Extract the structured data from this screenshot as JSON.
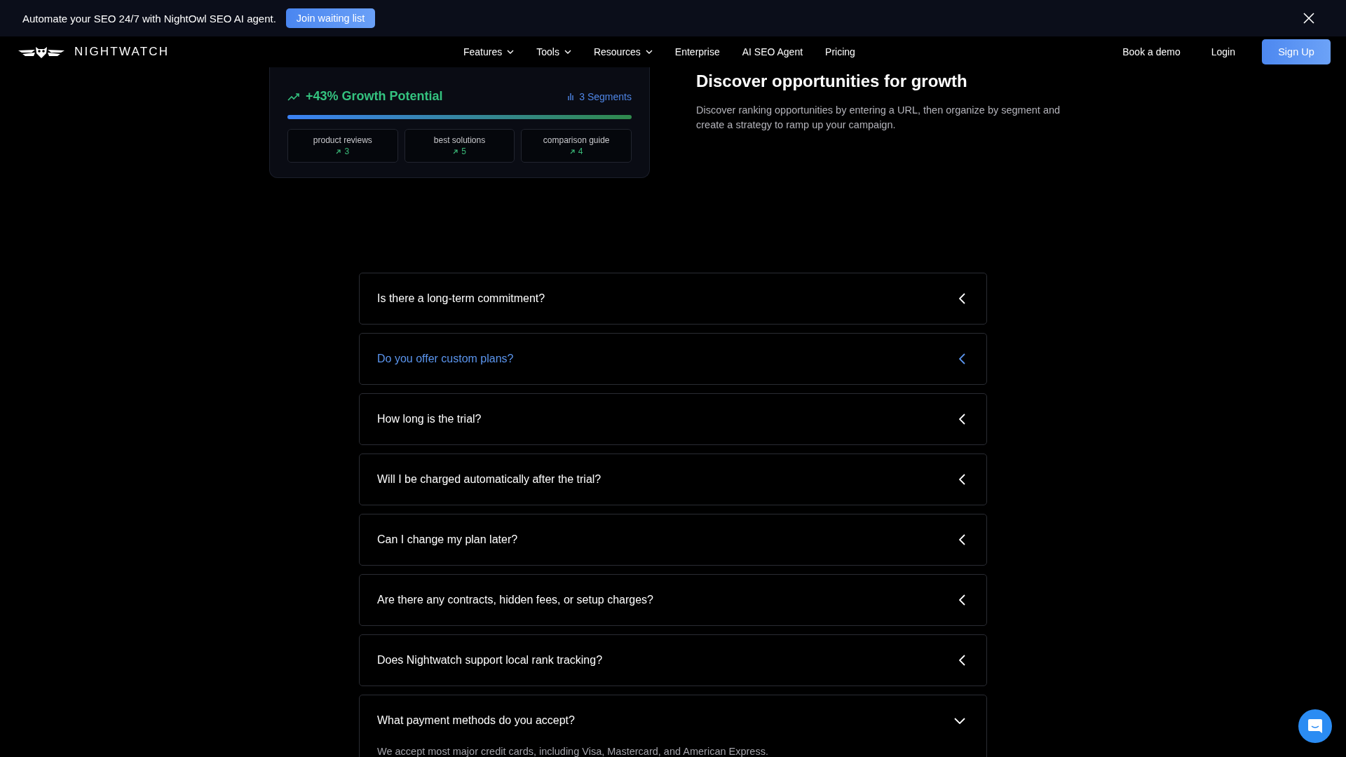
{
  "banner": {
    "text": "Automate your SEO 24/7 with NightOwl SEO AI agent.",
    "button": "Join waiting list"
  },
  "nav": {
    "logo": "NIGHTWATCH",
    "items": [
      {
        "label": "Features",
        "has_menu": true
      },
      {
        "label": "Tools",
        "has_menu": true
      },
      {
        "label": "Resources",
        "has_menu": true
      },
      {
        "label": "Enterprise",
        "has_menu": false
      },
      {
        "label": "AI SEO Agent",
        "has_menu": false
      },
      {
        "label": "Pricing",
        "has_menu": false
      }
    ],
    "book_demo": "Book a demo",
    "login": "Login",
    "signup": "Sign Up"
  },
  "growth_card": {
    "headline": "+43% Growth Potential",
    "segments": "3 Segments",
    "tiles": [
      {
        "label": "product reviews",
        "count": "3"
      },
      {
        "label": "best solutions",
        "count": "5"
      },
      {
        "label": "comparison guide",
        "count": "4"
      }
    ]
  },
  "feature": {
    "title": "Discover opportunities for growth",
    "body": "Discover ranking opportunities by entering a URL, then organize by segment and create a strategy to ramp up your campaign."
  },
  "faq": [
    {
      "question": "Is there a long-term commitment?",
      "highlighted": false,
      "expanded": false
    },
    {
      "question": "Do you offer custom plans?",
      "highlighted": true,
      "expanded": false
    },
    {
      "question": "How long is the trial?",
      "highlighted": false,
      "expanded": false
    },
    {
      "question": "Will I be charged automatically after the trial?",
      "highlighted": false,
      "expanded": false
    },
    {
      "question": "Can I change my plan later?",
      "highlighted": false,
      "expanded": false
    },
    {
      "question": "Are there any contracts, hidden fees, or setup charges?",
      "highlighted": false,
      "expanded": false
    },
    {
      "question": "Does Nightwatch support local rank tracking?",
      "highlighted": false,
      "expanded": false
    },
    {
      "question": "What payment methods do you accept?",
      "highlighted": false,
      "expanded": true,
      "answer": "We accept most major credit cards, including Visa, Mastercard, and American Express."
    }
  ]
}
